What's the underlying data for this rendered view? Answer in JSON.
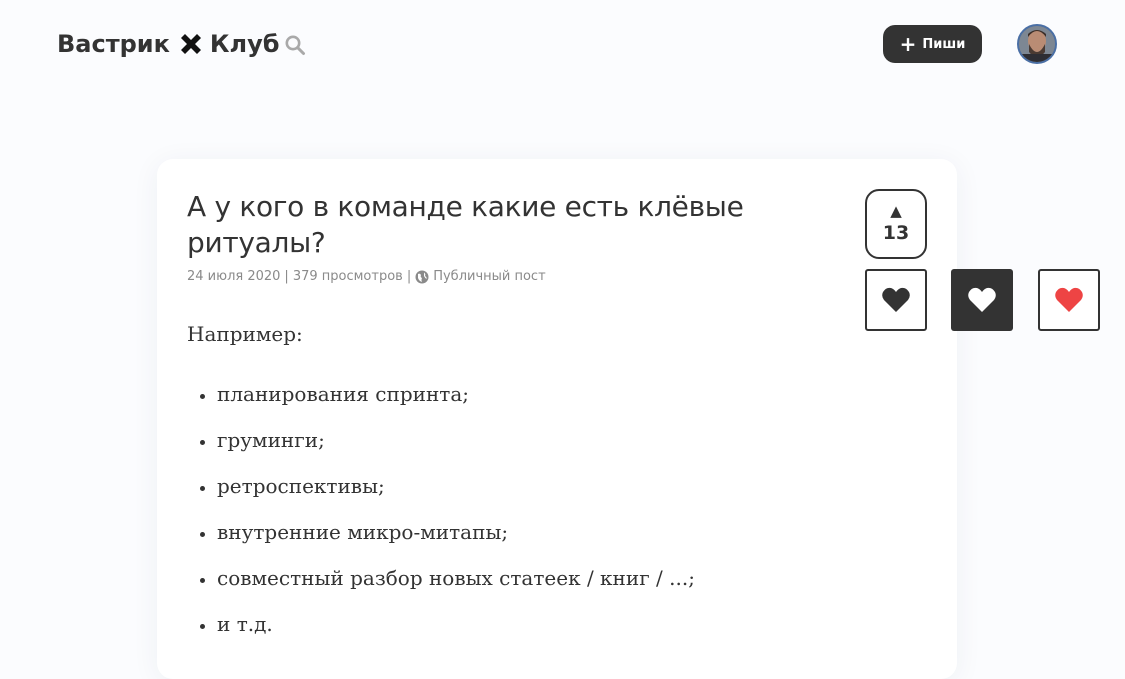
{
  "header": {
    "logo_left": "Вастрик",
    "logo_right": "Клуб",
    "write_button_label": "Пиши"
  },
  "post": {
    "title": "А у кого в команде какие есть клёвые ритуалы?",
    "date": "24 июля 2020",
    "views": "379 просмотров",
    "visibility": "Публичный пост",
    "intro": "Например:",
    "items": [
      "планирования спринта;",
      "груминги;",
      "ретроспективы;",
      "внутренние микро-митапы;",
      "совместный разбор новых статеек / книг / ...;",
      "и т.д."
    ]
  },
  "voting": {
    "arrow": "▲",
    "upvotes": "13"
  },
  "icons": {
    "logo_separator": "cross-icon",
    "search": "search-icon",
    "write_plus": "plus-icon",
    "visibility": "globe-icon",
    "reactions": [
      "heart-icon",
      "heart-icon",
      "heart-icon"
    ]
  },
  "colors": {
    "background": "#fbfcfe",
    "card": "#ffffff",
    "text": "#333333",
    "meta": "#8a8a8a",
    "button_dark": "#333333",
    "heart_red": "#ee4444"
  }
}
